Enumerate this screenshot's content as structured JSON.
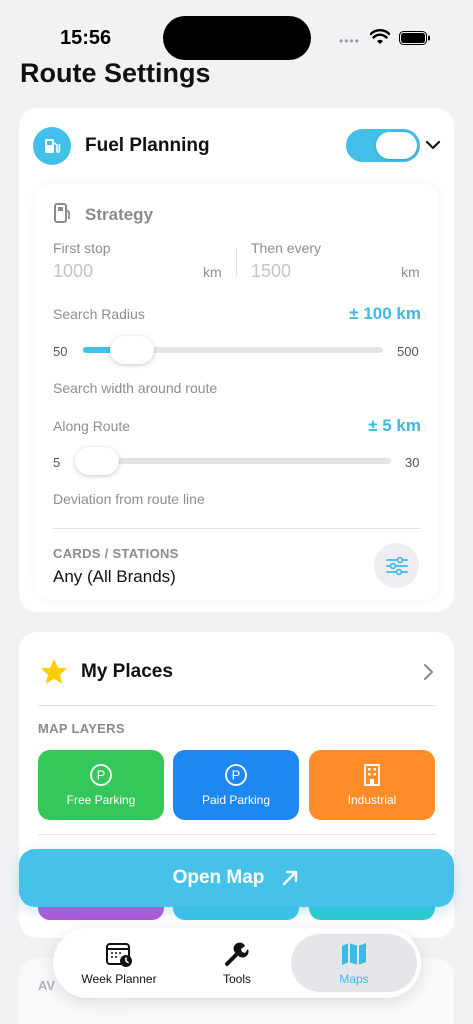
{
  "status_bar": {
    "time": "15:56",
    "dots": "••••"
  },
  "page": {
    "title": "Route Settings"
  },
  "fuel_planning": {
    "title": "Fuel Planning",
    "enabled": true,
    "strategy": {
      "title": "Strategy",
      "first_stop": {
        "label": "First stop",
        "placeholder": "1000",
        "unit": "km"
      },
      "then_every": {
        "label": "Then every",
        "placeholder": "1500",
        "unit": "km"
      },
      "search_radius": {
        "label": "Search Radius",
        "value_text": "± 100 km",
        "min": "50",
        "max": "500",
        "value": 100,
        "hint": "Search width around route"
      },
      "along_route": {
        "label": "Along Route",
        "value_text": "± 5 km",
        "min": "5",
        "max": "30",
        "value": 5,
        "hint": "Deviation from route line"
      },
      "cards": {
        "label": "CARDS / STATIONS",
        "value": "Any (All Brands)"
      }
    }
  },
  "my_places": {
    "title": "My Places",
    "layers_label": "MAP LAYERS",
    "layers": [
      {
        "label": "Free Parking",
        "color": "#34c759"
      },
      {
        "label": "Paid Parking",
        "color": "#1e88f0"
      },
      {
        "label": "Industrial",
        "color": "#ff8c28"
      }
    ],
    "peek_colors": [
      "#b155d6",
      "#3cc3e6",
      "#2ec9d3"
    ]
  },
  "open_map": {
    "label": "Open Map"
  },
  "available": {
    "label": "AV"
  },
  "tabs": [
    {
      "label": "Week Planner",
      "active": false
    },
    {
      "label": "Tools",
      "active": false
    },
    {
      "label": "Maps",
      "active": true
    }
  ],
  "colors": {
    "accent": "#42c0ea",
    "background": "#f2f2f5"
  }
}
